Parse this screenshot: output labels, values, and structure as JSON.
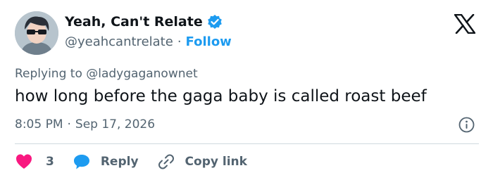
{
  "author": {
    "name": "Yeah, Can't Relate",
    "handle": "@yeahcantrelate",
    "separator": "·",
    "follow_label": "Follow"
  },
  "reply": {
    "prefix": "Replying to",
    "handle": "@ladygaganownet"
  },
  "tweet": {
    "text": "how long before the gaga baby is called roast beef",
    "time": "8:05 PM",
    "separator": "·",
    "date": "Sep 17, 2026"
  },
  "actions": {
    "likes_count": "3",
    "reply_label": "Reply",
    "copy_label": "Copy link"
  },
  "icons": {
    "verified": "verified-badge-icon",
    "brand": "x-logo-icon",
    "info": "info-icon",
    "like": "heart-icon",
    "reply": "speech-bubble-icon",
    "copy": "link-icon"
  },
  "colors": {
    "accent": "#1d9bf0",
    "like": "#f91880",
    "text": "#0f1419",
    "secondary": "#536471",
    "divider": "#cfd9de"
  }
}
